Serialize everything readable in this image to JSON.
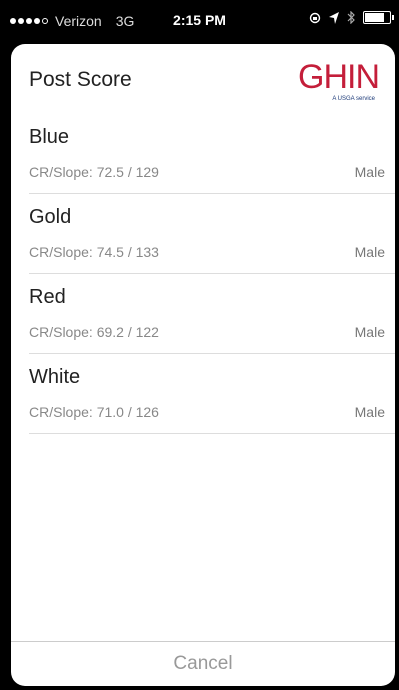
{
  "status_bar": {
    "carrier": "Verizon",
    "network": "3G",
    "time": "2:15 PM",
    "signal_bars_filled": 4,
    "signal_bars_total": 5,
    "battery_level": 0.85
  },
  "header": {
    "title": "Post Score",
    "logo_text": "GHIN",
    "logo_subtext": "A USGA service"
  },
  "tees": [
    {
      "name": "Blue",
      "detail": "CR/Slope: 72.5 / 129",
      "gender": "Male"
    },
    {
      "name": "Gold",
      "detail": "CR/Slope: 74.5 / 133",
      "gender": "Male"
    },
    {
      "name": "Red",
      "detail": "CR/Slope: 69.2 / 122",
      "gender": "Male"
    },
    {
      "name": "White",
      "detail": "CR/Slope: 71.0 / 126",
      "gender": "Male"
    }
  ],
  "footer": {
    "cancel_label": "Cancel"
  },
  "colors": {
    "brand": "#c41e3a",
    "brand_secondary": "#1c3a78"
  }
}
